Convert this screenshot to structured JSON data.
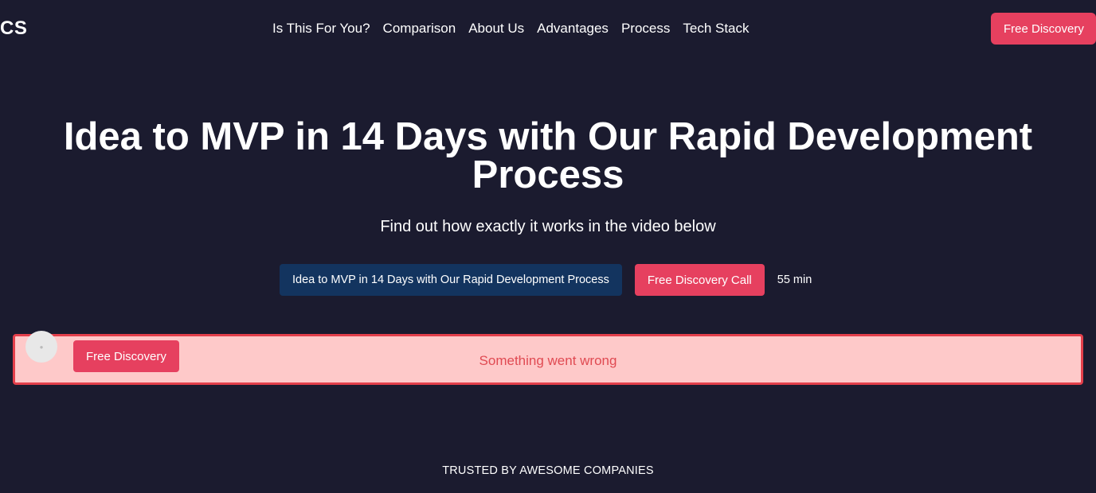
{
  "header": {
    "logo": "CS",
    "nav": [
      "Is This For You?",
      "Comparison",
      "About Us",
      "Advantages",
      "Process",
      "Tech Stack"
    ],
    "cta_label": "Free Discovery"
  },
  "hero": {
    "title": "Idea to MVP in 14 Days with Our Rapid Development Process",
    "subtitle": "Find out how exactly it works in the video below",
    "event_button": "Idea to MVP in 14 Days with Our Rapid Development Process",
    "call_button": "Free Discovery Call",
    "duration": "55 min"
  },
  "embed": {
    "error_message": "Something went wrong",
    "floating_cta": "Free Discovery",
    "avatar_icon": "avatar-placeholder-icon"
  },
  "trusted": {
    "label": "TRUSTED BY AWESOME COMPANIES"
  },
  "colors": {
    "background": "#1b1b2f",
    "accent": "#e6405f",
    "event_button": "#13345f",
    "error_bg": "#fec9c9",
    "error_border": "#e33f4b"
  }
}
